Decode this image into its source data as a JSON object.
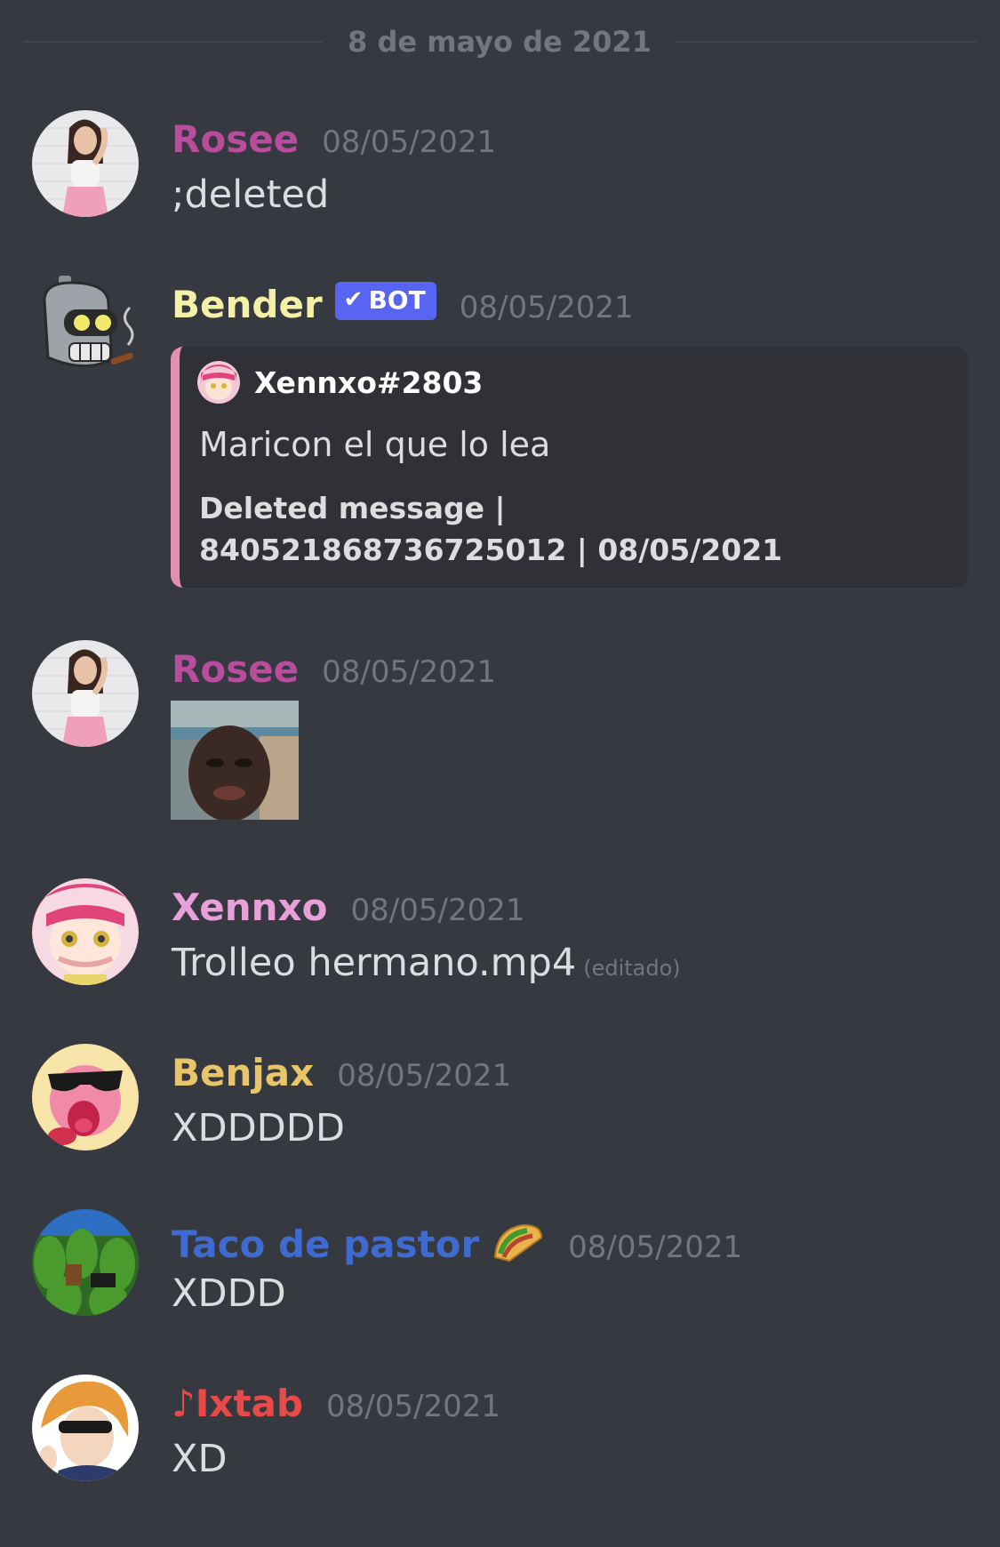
{
  "divider": {
    "date": "8 de mayo de 2021"
  },
  "messages": [
    {
      "author": "Rosee",
      "color": "#b84c9d",
      "time": "08/05/2021",
      "text": ";deleted"
    },
    {
      "author": "Bender",
      "color": "#f5f0a8",
      "time": "08/05/2021",
      "badge": "BOT",
      "embed": {
        "author": "Xennxo#2803",
        "description": "Maricon el que lo lea",
        "footer": "Deleted message | 840521868736725012 | 08/05/2021",
        "accent": "#e28fb0"
      }
    },
    {
      "author": "Rosee",
      "color": "#b84c9d",
      "time": "08/05/2021",
      "attachment": "image"
    },
    {
      "author": "Xennxo",
      "color": "#e8a0d8",
      "time": "08/05/2021",
      "text": "Trolleo hermano.mp4",
      "edited": "(editado)"
    },
    {
      "author": "Benjax",
      "color": "#e8c56a",
      "time": "08/05/2021",
      "text": "XDDDDD"
    },
    {
      "author": "Taco de pastor",
      "color": "#3f6ad0",
      "time": "08/05/2021",
      "emoji": "🌮",
      "text": "XDDD"
    },
    {
      "author": "♪Ixtab",
      "color": "#e84a4a",
      "time": "08/05/2021",
      "text": "XD"
    }
  ],
  "icons": [
    "verified-check-icon",
    "taco-icon"
  ]
}
